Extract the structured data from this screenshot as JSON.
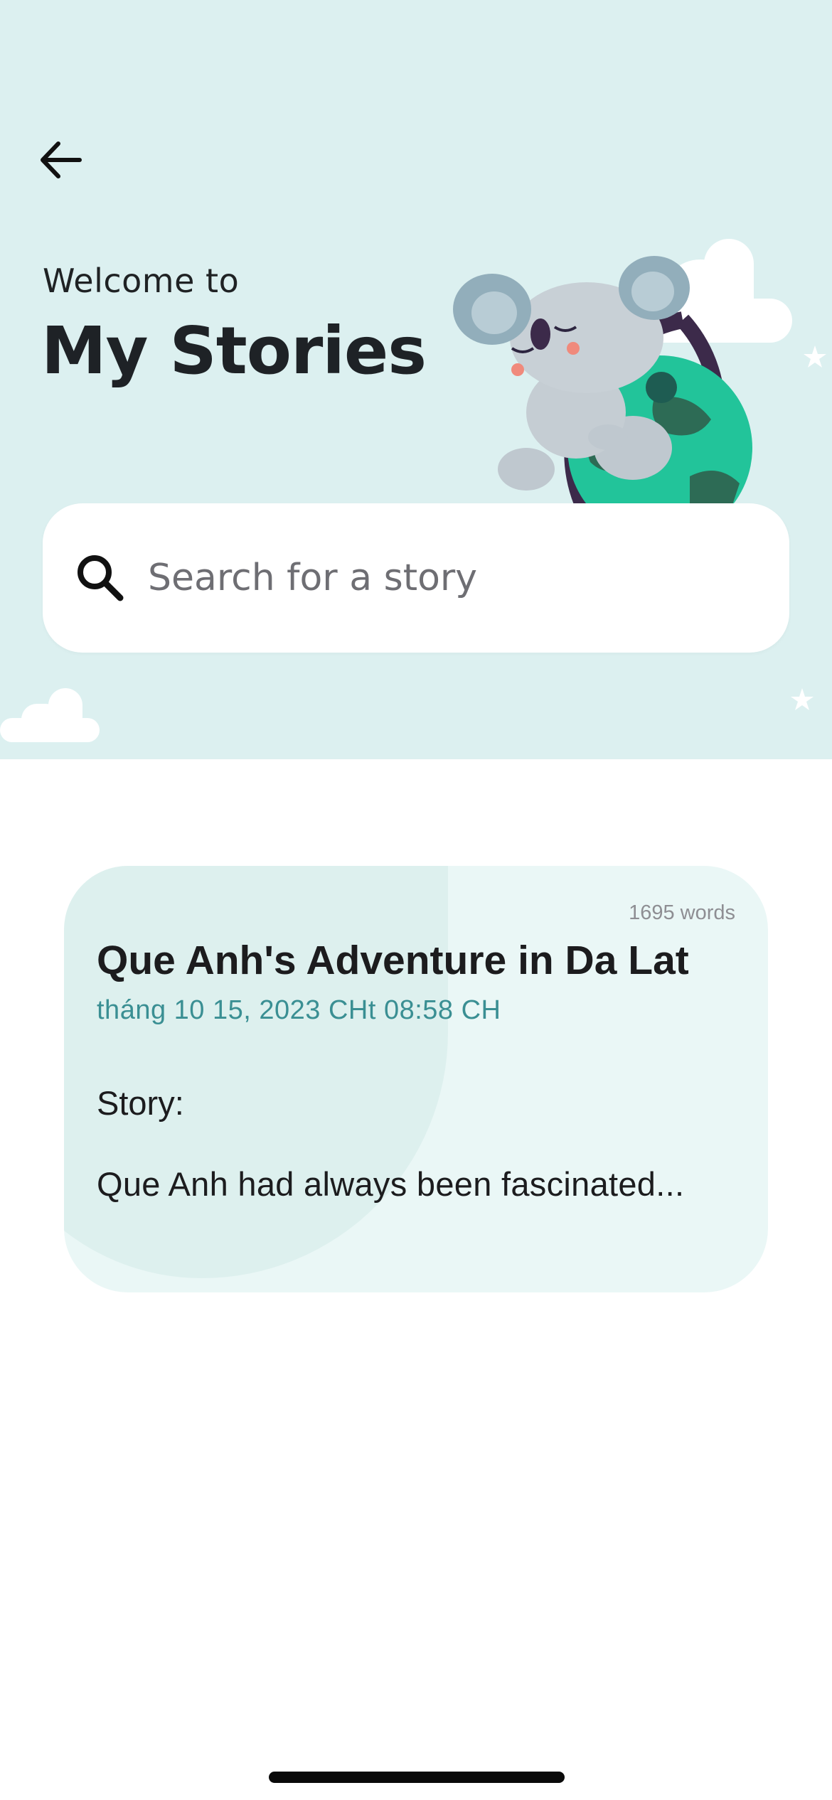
{
  "header": {
    "welcome_text": "Welcome to",
    "title": "My Stories",
    "background_color": "#dcf0f0",
    "back_icon": "arrow-left-icon",
    "illustration": "koala-hugging-globe"
  },
  "search": {
    "placeholder": "Search for a story",
    "value": "",
    "icon": "search-icon"
  },
  "stories": [
    {
      "word_count": "1695 words",
      "title": "Que Anh's Adventure in Da Lat",
      "date": "tháng 10 15, 2023 CHt 08:58 CH",
      "label": "Story:",
      "excerpt": "Que Anh had always been fascinated..."
    }
  ],
  "colors": {
    "accent_teal": "#3a8f93",
    "card_background": "#eaf7f6"
  }
}
